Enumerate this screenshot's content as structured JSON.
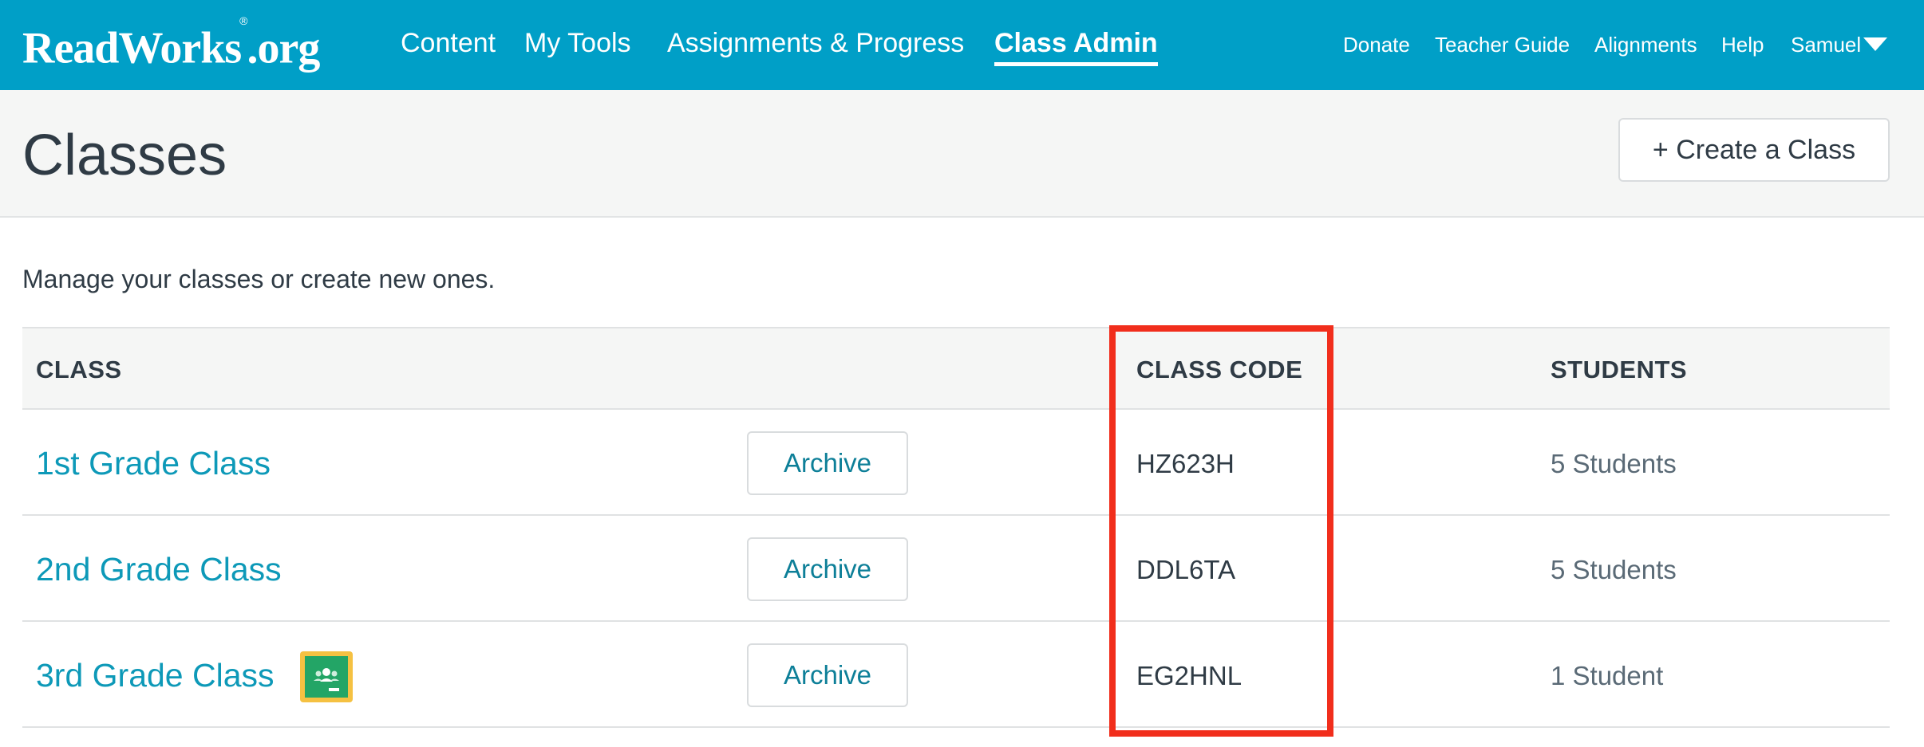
{
  "header": {
    "logo": "ReadWorks",
    "logo_suffix": ".org",
    "logo_mark": "®",
    "nav": [
      {
        "label": "Content"
      },
      {
        "label": "My Tools"
      },
      {
        "label": "Assignments & Progress"
      },
      {
        "label": "Class Admin",
        "active": true
      }
    ],
    "right_nav": [
      {
        "label": "Donate"
      },
      {
        "label": "Teacher Guide"
      },
      {
        "label": "Alignments"
      },
      {
        "label": "Help"
      }
    ],
    "user": "Samuel",
    "brand_color": "#009fc7"
  },
  "page": {
    "title": "Classes",
    "create_button": "+ Create a Class",
    "subtitle": "Manage your classes or create new ones."
  },
  "table": {
    "columns": [
      "CLASS",
      "CLASS CODE",
      "STUDENTS"
    ],
    "rows": [
      {
        "name": "1st Grade Class",
        "action": "Archive",
        "code": "HZ623H",
        "students": "5 Students"
      },
      {
        "name": "2nd Grade Class",
        "action": "Archive",
        "code": "DDL6TA",
        "students": "5 Students"
      },
      {
        "name": "3rd Grade Class",
        "action": "Archive",
        "code": "EG2HNL",
        "students": "1 Student",
        "icon": "google-classroom-icon"
      }
    ]
  },
  "highlight_color": "#f12e1c"
}
